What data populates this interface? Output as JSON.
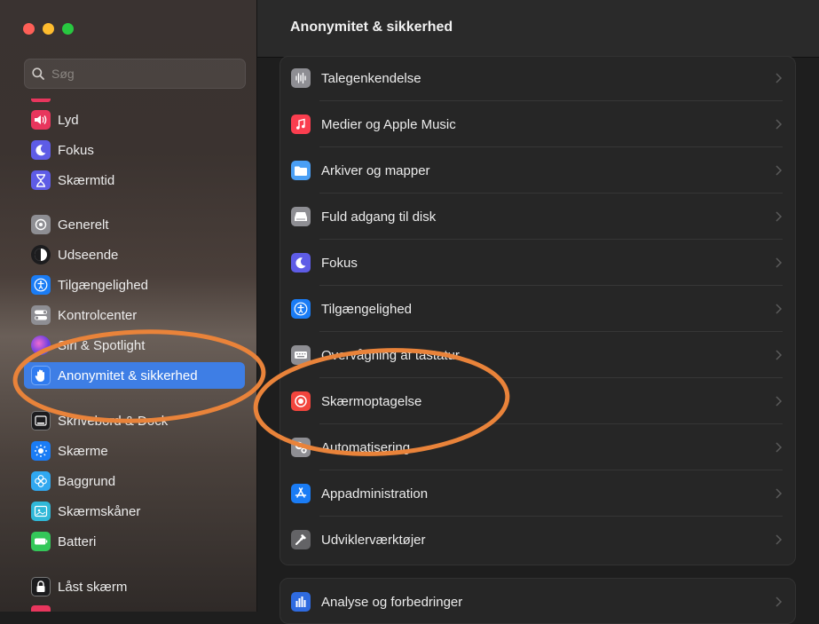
{
  "window": {
    "title": "Anonymitet & sikkerhed"
  },
  "search": {
    "placeholder": "Søg",
    "value": ""
  },
  "sidebar": {
    "items": [
      {
        "label": "Lyd",
        "icon": "speaker-icon",
        "color": "#e8365d"
      },
      {
        "label": "Fokus",
        "icon": "moon-icon",
        "color": "#5e5ce6"
      },
      {
        "label": "Skærmtid",
        "icon": "hourglass-icon",
        "color": "#5e5ce6"
      },
      {
        "label": "Generelt",
        "icon": "gear-icon",
        "color": "#8e8e93"
      },
      {
        "label": "Udseende",
        "icon": "appearance-icon",
        "color": "#1c1c1e"
      },
      {
        "label": "Tilgængelighed",
        "icon": "accessibility-icon",
        "color": "#1a7cf5"
      },
      {
        "label": "Kontrolcenter",
        "icon": "control-center-icon",
        "color": "#8e8e93"
      },
      {
        "label": "Siri & Spotlight",
        "icon": "siri-icon",
        "color": "#b04fd0"
      },
      {
        "label": "Anonymitet & sikkerhed",
        "icon": "hand-icon",
        "color": "#2f7bf0",
        "selected": true
      },
      {
        "label": "Skrivebord & Dock",
        "icon": "dock-icon",
        "color": "#1c1c1e"
      },
      {
        "label": "Skærme",
        "icon": "sun-icon",
        "color": "#1a7cf5"
      },
      {
        "label": "Baggrund",
        "icon": "flower-icon",
        "color": "#30a8f0"
      },
      {
        "label": "Skærmskåner",
        "icon": "screensaver-icon",
        "color": "#30b8d8"
      },
      {
        "label": "Batteri",
        "icon": "battery-icon",
        "color": "#34c759"
      },
      {
        "label": "Låst skærm",
        "icon": "lock-icon",
        "color": "#1c1c1e"
      }
    ]
  },
  "main": {
    "rows": [
      {
        "label": "Talegenkendelse",
        "icon": "waveform-icon",
        "color": "#8e8e93"
      },
      {
        "label": "Medier og Apple Music",
        "icon": "music-icon",
        "color": "#fa3e4f"
      },
      {
        "label": "Arkiver og mapper",
        "icon": "folder-icon",
        "color": "#4a9ff5"
      },
      {
        "label": "Fuld adgang til disk",
        "icon": "disk-icon",
        "color": "#8e8e93"
      },
      {
        "label": "Fokus",
        "icon": "moon-icon",
        "color": "#5e5ce6"
      },
      {
        "label": "Tilgængelighed",
        "icon": "accessibility-icon",
        "color": "#1a7cf5"
      },
      {
        "label": "Overvågning af tastatur",
        "icon": "keyboard-icon",
        "color": "#8e8e93"
      },
      {
        "label": "Skærmoptagelse",
        "icon": "record-icon",
        "color": "#f2453d"
      },
      {
        "label": "Automatisering",
        "icon": "gears-icon",
        "color": "#8e8e93"
      },
      {
        "label": "Appadministration",
        "icon": "appstore-icon",
        "color": "#1a7cf5"
      },
      {
        "label": "Udviklerværktøjer",
        "icon": "hammer-icon",
        "color": "#636366"
      }
    ],
    "analytics_row": {
      "label": "Analyse og forbedringer",
      "icon": "chart-icon",
      "color": "#2f6be0"
    }
  },
  "colors": {
    "accent": "#3e7ee5",
    "annotation": "#e9833a"
  }
}
